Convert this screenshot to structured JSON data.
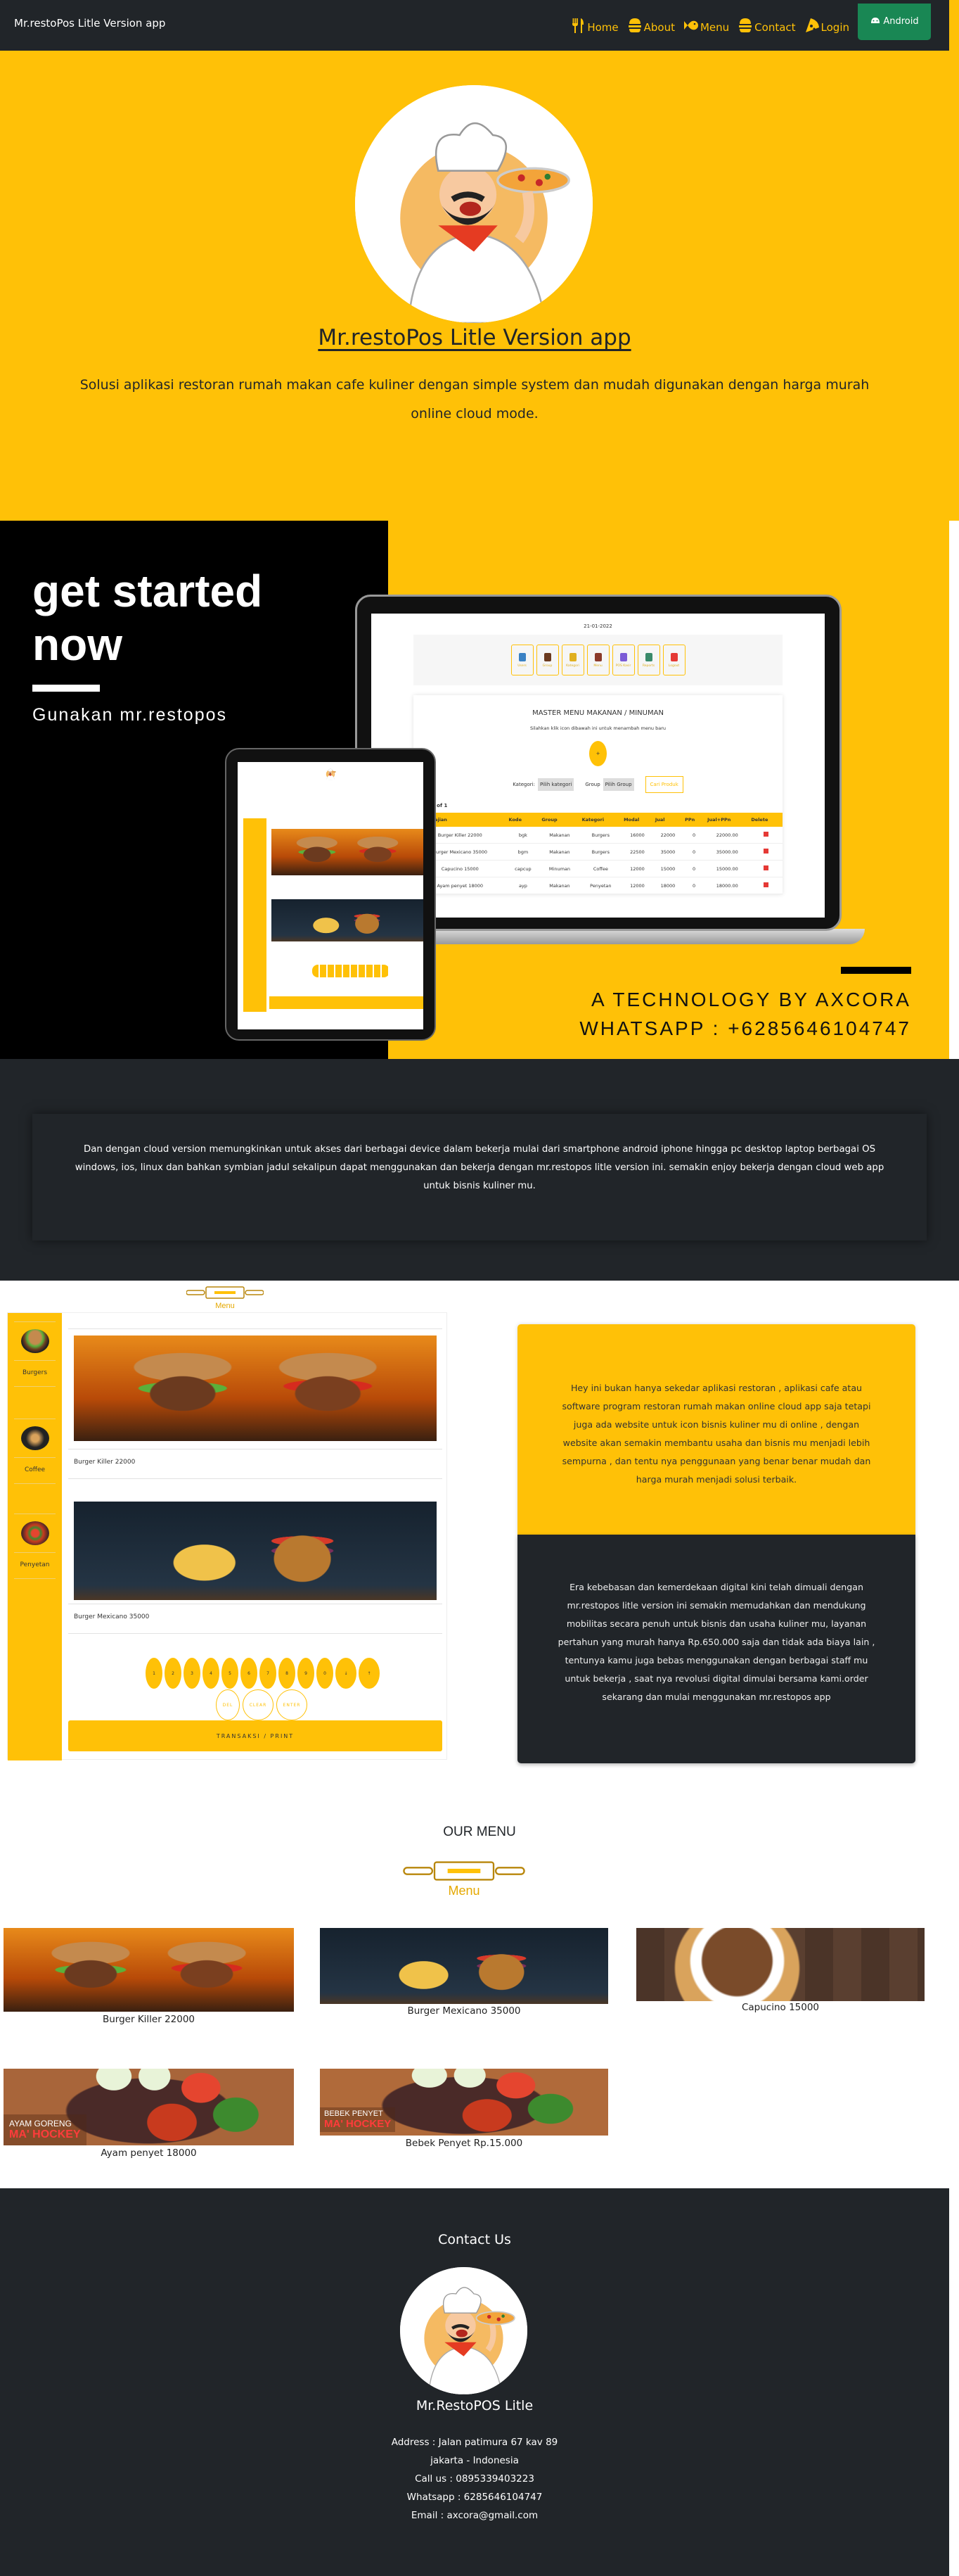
{
  "navbar": {
    "brand": "Mr.restoPos Litle Version app",
    "items": [
      {
        "label": "Home",
        "icon": "utensils-icon"
      },
      {
        "label": "About",
        "icon": "burger-icon"
      },
      {
        "label": "Menu",
        "icon": "fish-icon"
      },
      {
        "label": "Contact",
        "icon": "burger-icon"
      },
      {
        "label": "Login",
        "icon": "pizza-icon"
      }
    ],
    "android_label": "Android",
    "colors": {
      "bg": "#212529",
      "accent": "#FFC107",
      "android": "#198754"
    }
  },
  "hero": {
    "title": "Mr.restoPos Litle Version app",
    "subtitle": "Solusi aplikasi restoran rumah makan cafe kuliner dengan simple system dan mudah digunakan dengan harga murah online cloud mode."
  },
  "get_started": {
    "title_line1": "get started",
    "title_line2": "now",
    "subtitle": "Gunakan mr.restopos",
    "tech_line": "A TECHNOLOGY BY AXCORA",
    "whatsapp_line": "WHATSAPP : +6285646104747",
    "laptop_screen": {
      "date": "21-01-2022",
      "toolbar": [
        "Users",
        "Group",
        "Kategori",
        "Menu",
        "POS Kasir",
        "Reports",
        "Logout"
      ],
      "heading": "MASTER MENU MAKANAN / MINUMAN",
      "hint": "Silahkan klik icon dibawah ini untuk menambah menu baru",
      "add_label": "+",
      "kategori_label": "Kategori:",
      "kategori_value": "Pilih kategori",
      "group_label": "Group",
      "group_value": "Pilih Group",
      "search_label": "Cari Produk",
      "page_info": "Page 1 of 1",
      "columns": [
        "Menu Sajian",
        "Kode",
        "Group",
        "Kategori",
        "Modal",
        "Jual",
        "PPn",
        "Jual+PPn",
        "Delete"
      ],
      "rows": [
        [
          "Burger Killer 22000",
          "bgk",
          "Makanan",
          "Burgers",
          "16000",
          "22000",
          "0",
          "22000.00"
        ],
        [
          "Burger Mexicano 35000",
          "bgm",
          "Makanan",
          "Burgers",
          "22500",
          "35000",
          "0",
          "35000.00"
        ],
        [
          "Capucino 15000",
          "capcup",
          "Minuman",
          "Coffee",
          "12000",
          "15000",
          "0",
          "15000.00"
        ],
        [
          "Ayam penyet 18000",
          "ayp",
          "Makanan",
          "Penyetan",
          "12000",
          "18000",
          "0",
          "18000.00"
        ]
      ]
    }
  },
  "cloud": {
    "text": "Dan dengan cloud version memungkinkan untuk akses dari berbagai device dalam bekerja mulai dari smartphone android iphone hingga pc desktop laptop berbagai OS windows, ios, linux dan bahkan symbian jadul sekalipun dapat menggunakan dan bekerja dengan mr.restopos litle version ini. semakin enjoy bekerja dengan cloud web app untuk bisnis kuliner mu."
  },
  "pos_demo": {
    "menu_badge": "Menu",
    "categories": [
      "Burgers",
      "Coffee",
      "Penyetan"
    ],
    "items": [
      "Burger Killer 22000",
      "Burger Mexicano 35000"
    ],
    "keypad": [
      "1",
      "2",
      "3",
      "4",
      "5",
      "6",
      "7",
      "8",
      "9",
      "0",
      "↓",
      "↑"
    ],
    "actions": [
      "DEL",
      "CLEAR",
      "ENTER"
    ],
    "print_label": "TRANSAKSI / PRINT"
  },
  "info": {
    "yellow_text": "Hey ini bukan hanya sekedar aplikasi restoran , aplikasi cafe atau software program restoran rumah makan online cloud app saja tetapi juga ada website untuk icon bisnis kuliner mu di online , dengan website akan semakin membantu usaha dan bisnis mu menjadi lebih sempurna , dan tentu nya penggunaan yang benar benar mudah dan harga murah menjadi solusi terbaik.",
    "dark_text": "Era kebebasan dan kemerdekaan digital kini telah dimuali dengan mr.restopos litle version ini semakin memudahkan dan mendukung mobilitas secara penuh untuk bisnis dan usaha kuliner mu, layanan pertahun yang murah hanya Rp.650.000 saja dan tidak ada biaya lain , tentunya kamu juga bebas menggunakan dengan berbagai staff mu untuk bekerja , saat nya revolusi digital dimulai bersama kami.order sekarang dan mulai menggunakan mr.restopos app"
  },
  "our_menu": {
    "title": "OUR MENU",
    "badge": "Menu",
    "items": [
      {
        "caption": "Burger Killer 22000"
      },
      {
        "caption": "Burger Mexicano 35000"
      },
      {
        "caption": "Capucino 15000"
      },
      {
        "caption": "Ayam penyet 18000",
        "overlay_top": "AYAM GORENG",
        "overlay_brand": "MA' HOCKEY"
      },
      {
        "caption": "Bebek Penyet Rp.15.000",
        "overlay_top": "BEBEK PENYET",
        "overlay_brand": "MA' HOCKEY"
      }
    ]
  },
  "footer": {
    "title": "Contact Us",
    "name": "Mr.RestoPOS Litle",
    "lines": [
      "Address : Jalan patimura 67 kav 89",
      "jakarta - Indonesia",
      "Call us : 0895339403223",
      "Whatsapp : 6285646104747",
      "Email : axcora@gmail.com"
    ]
  }
}
